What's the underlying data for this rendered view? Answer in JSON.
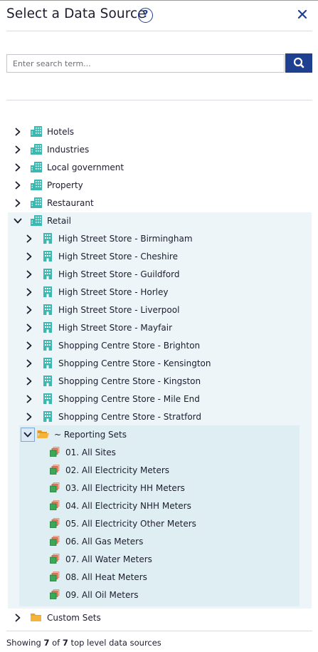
{
  "dialog": {
    "title": "Select a Data Source",
    "help_symbol": "?",
    "close_icon": "close-icon"
  },
  "search": {
    "placeholder": "Enter search term...",
    "value": "",
    "button_icon": "search-icon"
  },
  "tree": {
    "top_level": [
      {
        "label": "Hotels",
        "icon": "building-group-icon",
        "expanded": false
      },
      {
        "label": "Industries",
        "icon": "building-group-icon",
        "expanded": false
      },
      {
        "label": "Local government",
        "icon": "building-group-icon",
        "expanded": false
      },
      {
        "label": "Property",
        "icon": "building-group-icon",
        "expanded": false
      },
      {
        "label": "Restaurant",
        "icon": "building-group-icon",
        "expanded": false
      },
      {
        "label": "Retail",
        "icon": "building-group-icon",
        "expanded": true
      }
    ],
    "retail_children": [
      {
        "label": "High Street Store - Birmingham",
        "icon": "building-icon"
      },
      {
        "label": "High Street Store - Cheshire",
        "icon": "building-icon"
      },
      {
        "label": "High Street Store - Guildford",
        "icon": "building-icon"
      },
      {
        "label": "High Street Store - Horley",
        "icon": "building-icon"
      },
      {
        "label": "High Street Store - Liverpool",
        "icon": "building-icon"
      },
      {
        "label": "High Street Store - Mayfair",
        "icon": "building-icon"
      },
      {
        "label": "Shopping Centre Store - Brighton",
        "icon": "building-icon"
      },
      {
        "label": "Shopping Centre Store - Kensington",
        "icon": "building-icon"
      },
      {
        "label": "Shopping Centre Store - Kingston",
        "icon": "building-icon"
      },
      {
        "label": "Shopping Centre Store - Mile End",
        "icon": "building-icon"
      },
      {
        "label": "Shopping Centre Store - Stratford",
        "icon": "building-icon"
      }
    ],
    "reporting_sets": {
      "label": "~ Reporting Sets",
      "icon": "folder-open-icon",
      "expanded": true,
      "items": [
        {
          "label": "01. All Sites",
          "icon": "reporting-set-icon"
        },
        {
          "label": "02. All Electricity Meters",
          "icon": "reporting-set-icon"
        },
        {
          "label": "03. All Electricity HH Meters",
          "icon": "reporting-set-icon"
        },
        {
          "label": "04. All Electricity NHH Meters",
          "icon": "reporting-set-icon"
        },
        {
          "label": "05. All Electricity Other Meters",
          "icon": "reporting-set-icon"
        },
        {
          "label": "06. All Gas Meters",
          "icon": "reporting-set-icon"
        },
        {
          "label": "07. All Water Meters",
          "icon": "reporting-set-icon"
        },
        {
          "label": "08. All Heat Meters",
          "icon": "reporting-set-icon"
        },
        {
          "label": "09. All Oil Meters",
          "icon": "reporting-set-icon"
        }
      ]
    },
    "custom_sets": {
      "label": "Custom Sets",
      "icon": "folder-icon",
      "expanded": false
    }
  },
  "footer": {
    "prefix": "Showing ",
    "shown": "7",
    "of": " of ",
    "total": "7",
    "suffix": " top level data sources"
  },
  "colors": {
    "accent": "#1f3f91",
    "building_teal": "#3bb8b0",
    "folder_orange": "#f3a321",
    "expanded_bg": "#eef5f8",
    "selected_bg": "#dfeef3"
  }
}
